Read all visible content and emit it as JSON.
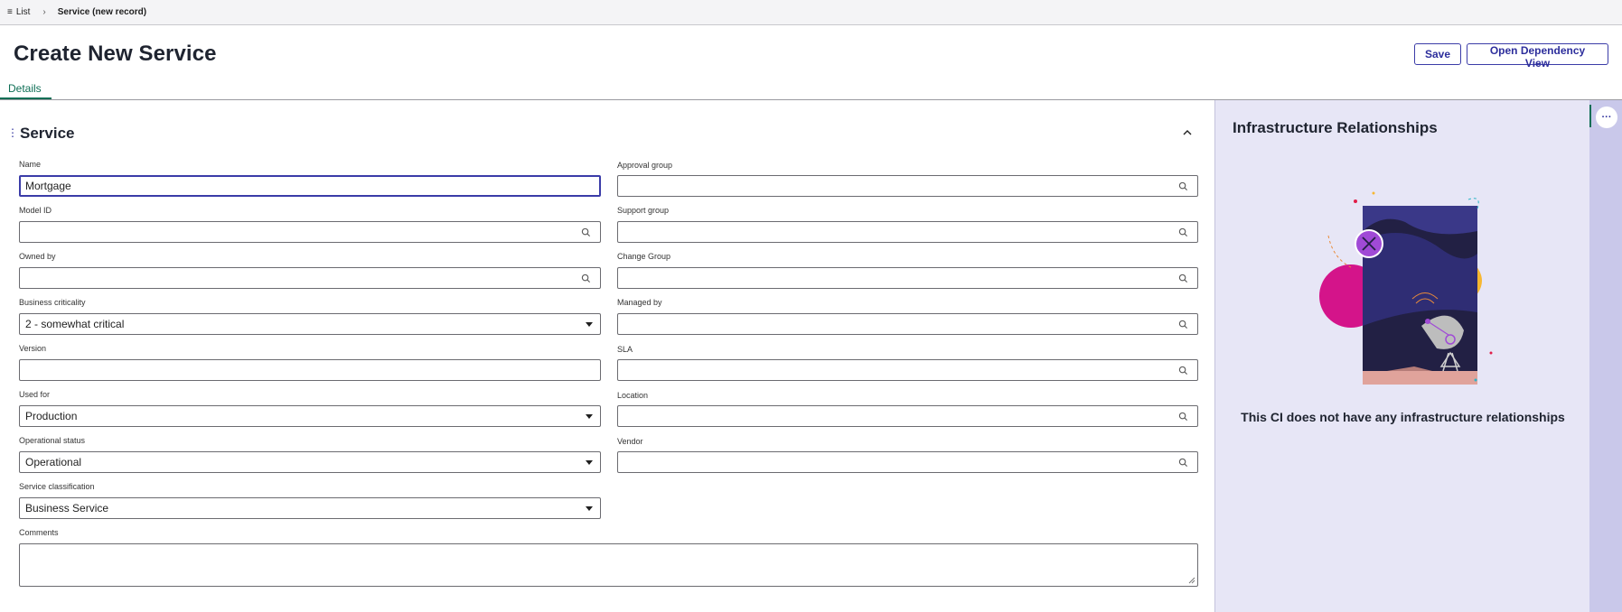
{
  "breadcrumb": {
    "list_label": "List",
    "current": "Service (new record)"
  },
  "page": {
    "title": "Create New Service"
  },
  "actions": {
    "save_label": "Save",
    "dependency_label": "Open Dependency View"
  },
  "tabs": [
    {
      "label": "Details",
      "active": true
    }
  ],
  "section": {
    "title": "Service"
  },
  "form": {
    "name": {
      "label": "Name",
      "value": "Mortgage"
    },
    "model_id": {
      "label": "Model ID",
      "value": ""
    },
    "owned_by": {
      "label": "Owned by",
      "value": ""
    },
    "business_criticality": {
      "label": "Business criticality",
      "value": "2 - somewhat critical"
    },
    "version": {
      "label": "Version",
      "value": ""
    },
    "used_for": {
      "label": "Used for",
      "value": "Production"
    },
    "operational_status": {
      "label": "Operational status",
      "value": "Operational"
    },
    "service_classification": {
      "label": "Service classification",
      "value": "Business Service"
    },
    "comments": {
      "label": "Comments",
      "value": ""
    },
    "approval_group": {
      "label": "Approval group",
      "value": ""
    },
    "support_group": {
      "label": "Support group",
      "value": ""
    },
    "change_group": {
      "label": "Change Group",
      "value": ""
    },
    "managed_by": {
      "label": "Managed by",
      "value": ""
    },
    "sla": {
      "label": "SLA",
      "value": ""
    },
    "location": {
      "label": "Location",
      "value": ""
    },
    "vendor": {
      "label": "Vendor",
      "value": ""
    }
  },
  "panel": {
    "title": "Infrastructure Relationships",
    "empty_message": "This CI does not have any infrastructure relationships"
  },
  "icons": {
    "list": "list-icon",
    "chevron": "chevron-right-icon",
    "collapse": "chevron-up-icon",
    "lookup": "search-icon",
    "dropdown": "caret-down-icon",
    "more": "ellipsis-icon",
    "drag": "drag-handle-icon"
  },
  "colors": {
    "accent": "#3b3ca8",
    "tab_active": "#0d6e55",
    "panel_bg": "#e7e6f6",
    "rail_bg": "#c9c8ea"
  }
}
